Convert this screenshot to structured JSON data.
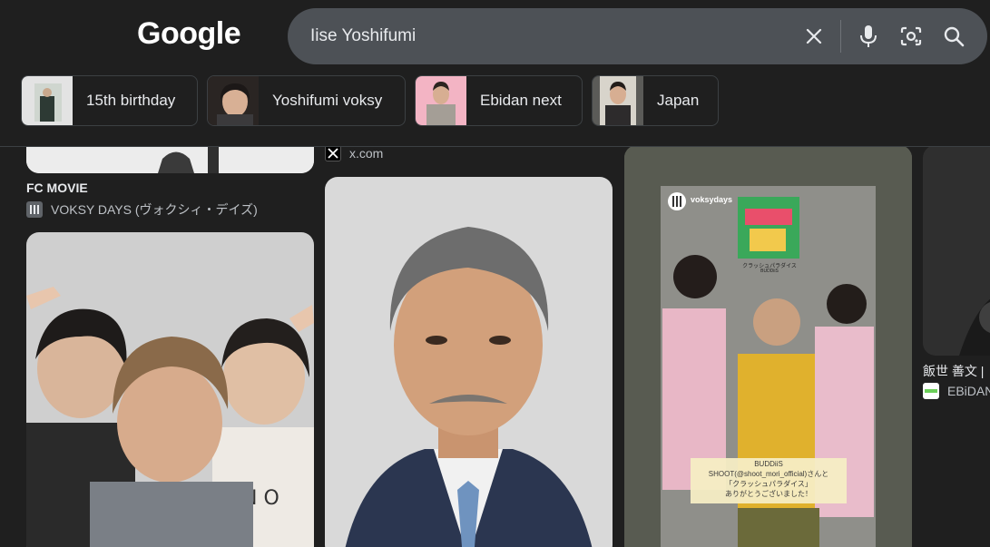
{
  "header": {
    "logo": "Google",
    "search": {
      "value": "Iise Yoshifumi"
    },
    "icons": [
      "clear-icon",
      "microphone-icon",
      "lens-icon",
      "search-icon"
    ]
  },
  "chips": [
    {
      "label": "15th birthday"
    },
    {
      "label": "Yoshifumi voksy"
    },
    {
      "label": "Ebidan next"
    },
    {
      "label": "Japan"
    }
  ],
  "results": {
    "col1_top": {
      "title": "FC MOVIE",
      "source": "VOKSY DAYS (ヴォクシィ・デイズ)"
    },
    "col2_top": {
      "source": "x.com"
    },
    "col3": {
      "story_user": "voksydays",
      "album_title": "クラッシュパラダイス",
      "album_sub": "BUDDiiS",
      "caption_line1": "BUDDiiS",
      "caption_line2": "SHOOT(@shoot_mori_official)さんと",
      "caption_line3": "「クラッシュパラダイス」",
      "caption_line4": "ありがとうございました！"
    },
    "col4": {
      "title": "飯世 善文 |",
      "source": "EBiDAN"
    }
  },
  "colors": {
    "background": "#1f1f1f",
    "search_bg": "#4d5156",
    "text": "#e8eaed",
    "muted": "#bdc1c6"
  }
}
